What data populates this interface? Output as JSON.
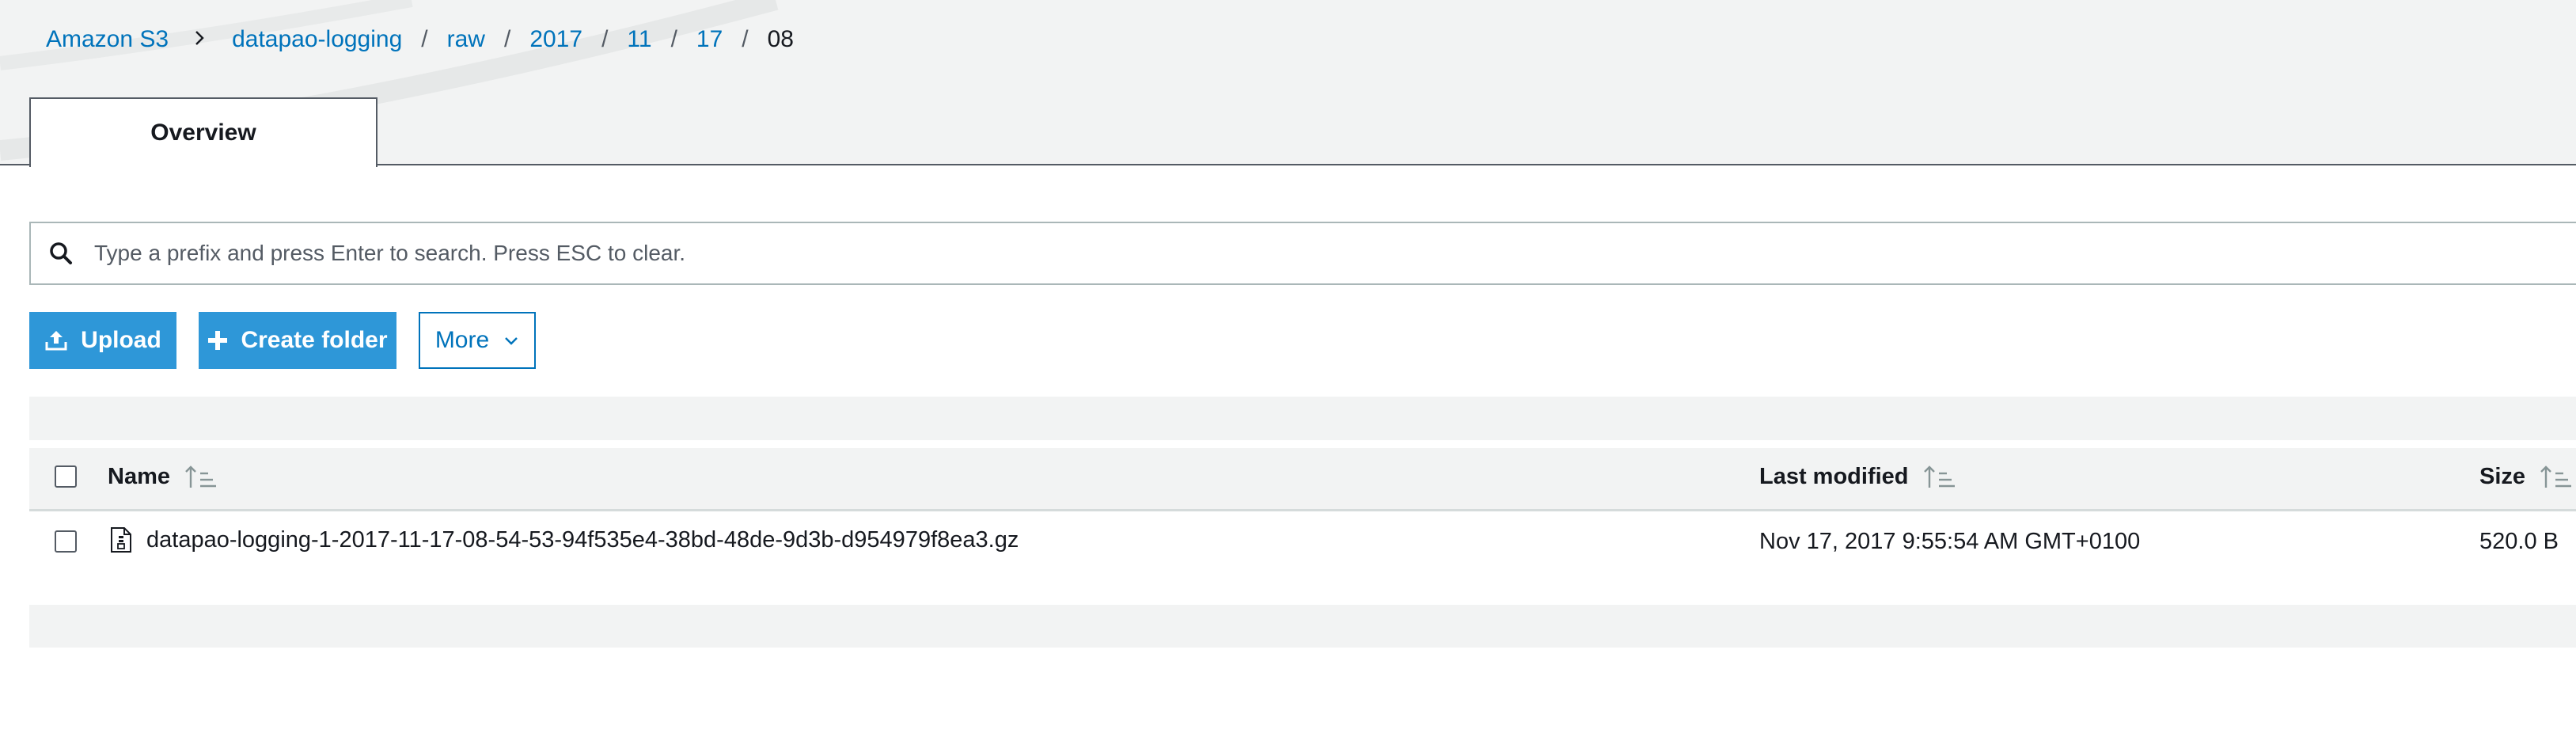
{
  "breadcrumb": {
    "root": "Amazon S3",
    "bucket": "datapao-logging",
    "segments": [
      "raw",
      "2017",
      "11",
      "17"
    ],
    "current": "08"
  },
  "tabs": [
    {
      "label": "Overview",
      "active": true
    }
  ],
  "search": {
    "placeholder": "Type a prefix and press Enter to search. Press ESC to clear.",
    "value": ""
  },
  "toolbar": {
    "upload_label": "Upload",
    "create_folder_label": "Create folder",
    "more_label": "More"
  },
  "table": {
    "columns": [
      "Name",
      "Last modified",
      "Size"
    ],
    "rows": [
      {
        "name": "datapao-logging-1-2017-11-17-08-54-53-94f535e4-38bd-48de-9d3b-d954979f8ea3.gz",
        "last_modified": "Nov 17, 2017 9:55:54 AM GMT+0100",
        "size": "520.0 B",
        "checked": false
      }
    ]
  },
  "icons": {
    "search": "search-icon",
    "upload": "upload-icon",
    "create_folder": "plus-icon",
    "more": "chevron-down-icon",
    "sort": "sort-icon",
    "file": "file-icon",
    "breadcrumb_separator": "chevron-right-icon"
  },
  "colors": {
    "link": "#0073bb",
    "primary_button": "#2e97d8",
    "header_background": "#f2f3f3",
    "text": "#16191f"
  }
}
